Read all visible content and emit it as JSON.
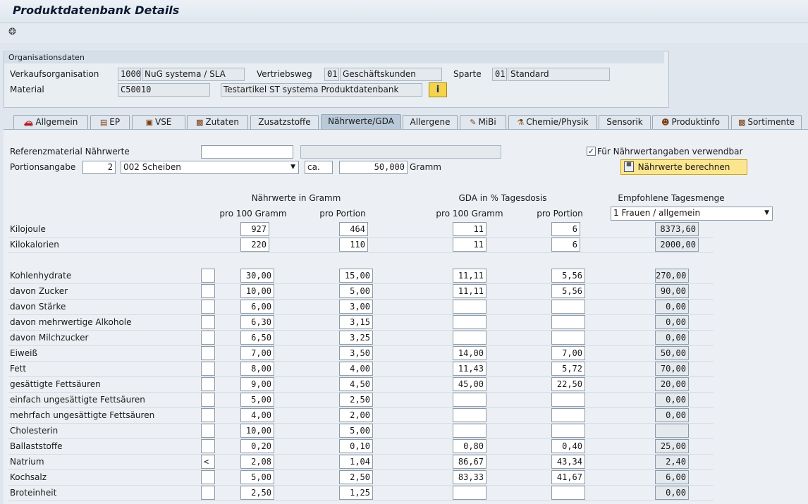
{
  "window": {
    "title": "Produktdatenbank Details"
  },
  "org": {
    "title": "Organisationsdaten",
    "vk_label": "Verkaufsorganisation",
    "vk_code": "1000",
    "vk_name": "NuG systema / SLA",
    "vw_label": "Vertriebsweg",
    "vw_code": "01",
    "vw_name": "Geschäftskunden",
    "sp_label": "Sparte",
    "sp_code": "01",
    "sp_name": "Standard",
    "mat_label": "Material",
    "mat_code": "C50010",
    "mat_name": "Testartikel ST systema Produktdatenbank"
  },
  "tabs": [
    "Allgemein",
    "EP",
    "VSE",
    "Zutaten",
    "Zusatzstoffe",
    "Nährwerte/GDA",
    "Allergene",
    "MiBi",
    "Chemie/Physik",
    "Sensorik",
    "Produktinfo",
    "Sortimente"
  ],
  "active_tab": "Nährwerte/GDA",
  "form": {
    "ref_label": "Referenzmaterial Nährwerte",
    "ref_value": "",
    "ref_desc": "",
    "portion_label": "Portionsangabe",
    "portion_qty": "2",
    "portion_unit": "002 Scheiben",
    "ca": "ca.",
    "weight": "50,000",
    "weight_unit": "Gramm",
    "checkbox_label": "Für Nährwertangaben verwendbar",
    "checkbox_checked": true,
    "calc_button": "Nährwerte berechnen"
  },
  "headers": {
    "grams": "Nährwerte in Gramm",
    "gda": "GDA in % Tagesdosis",
    "recommended": "Empfohlene Tagesmenge",
    "per100_a": "pro 100 Gramm",
    "portion_a": "pro Portion",
    "per100_b": "pro 100 Gramm",
    "portion_b": "pro Portion",
    "rec_select": "1 Frauen / allgemein"
  },
  "energy": [
    {
      "label": "Kilojoule",
      "g100": "927",
      "gport": "464",
      "gda100": "11",
      "gdaport": "6",
      "rec": "8373,60"
    },
    {
      "label": "Kilokalorien",
      "g100": "220",
      "gport": "110",
      "gda100": "11",
      "gdaport": "6",
      "rec": "2000,00"
    }
  ],
  "nutrients": [
    {
      "label": "Kohlenhydrate",
      "flag": "",
      "g100": "30,00",
      "gport": "15,00",
      "gda100": "11,11",
      "gdaport": "5,56",
      "rec": "270,00"
    },
    {
      "label": "davon Zucker",
      "flag": "",
      "g100": "10,00",
      "gport": "5,00",
      "gda100": "11,11",
      "gdaport": "5,56",
      "rec": "90,00"
    },
    {
      "label": "davon Stärke",
      "flag": "",
      "g100": "6,00",
      "gport": "3,00",
      "gda100": "",
      "gdaport": "",
      "rec": "0,00"
    },
    {
      "label": "davon mehrwertige Alkohole",
      "flag": "",
      "g100": "6,30",
      "gport": "3,15",
      "gda100": "",
      "gdaport": "",
      "rec": "0,00"
    },
    {
      "label": "davon Milchzucker",
      "flag": "",
      "g100": "6,50",
      "gport": "3,25",
      "gda100": "",
      "gdaport": "",
      "rec": "0,00"
    },
    {
      "label": "Eiweiß",
      "flag": "",
      "g100": "7,00",
      "gport": "3,50",
      "gda100": "14,00",
      "gdaport": "7,00",
      "rec": "50,00"
    },
    {
      "label": "Fett",
      "flag": "",
      "g100": "8,00",
      "gport": "4,00",
      "gda100": "11,43",
      "gdaport": "5,72",
      "rec": "70,00"
    },
    {
      "label": "gesättigte Fettsäuren",
      "flag": "",
      "g100": "9,00",
      "gport": "4,50",
      "gda100": "45,00",
      "gdaport": "22,50",
      "rec": "20,00"
    },
    {
      "label": "einfach ungesättigte Fettsäuren",
      "flag": "",
      "g100": "5,00",
      "gport": "2,50",
      "gda100": "",
      "gdaport": "",
      "rec": "0,00"
    },
    {
      "label": "mehrfach ungesättigte Fettsäuren",
      "flag": "",
      "g100": "4,00",
      "gport": "2,00",
      "gda100": "",
      "gdaport": "",
      "rec": "0,00"
    },
    {
      "label": "Cholesterin",
      "flag": "",
      "g100": "10,00",
      "gport": "5,00",
      "gda100": "",
      "gdaport": "",
      "rec": ""
    },
    {
      "label": "Ballaststoffe",
      "flag": "",
      "g100": "0,20",
      "gport": "0,10",
      "gda100": "0,80",
      "gdaport": "0,40",
      "rec": "25,00"
    },
    {
      "label": "Natrium",
      "flag": "<",
      "g100": "2,08",
      "gport": "1,04",
      "gda100": "86,67",
      "gdaport": "43,34",
      "rec": "2,40"
    },
    {
      "label": "Kochsalz",
      "flag": "",
      "g100": "5,00",
      "gport": "2,50",
      "gda100": "83,33",
      "gdaport": "41,67",
      "rec": "6,00"
    },
    {
      "label": "Broteinheit",
      "flag": "",
      "g100": "2,50",
      "gport": "1,25",
      "gda100": "",
      "gdaport": "",
      "rec": "0,00"
    }
  ]
}
